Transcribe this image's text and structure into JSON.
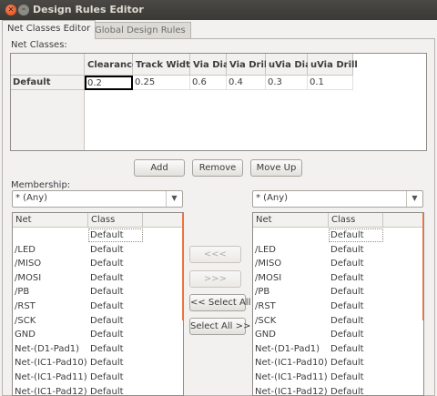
{
  "window": {
    "title": "Design Rules Editor"
  },
  "tabs": [
    {
      "label": "Net Classes Editor",
      "active": true
    },
    {
      "label": "Global Design Rules",
      "active": false
    }
  ],
  "net_classes": {
    "label": "Net Classes:",
    "columns": [
      "Clearance",
      "Track Width",
      "Via Dia",
      "Via Drill",
      "uVia Dia",
      "uVia Drill"
    ],
    "rows": [
      {
        "name": "Default",
        "values": [
          "0.2",
          "0.25",
          "0.6",
          "0.4",
          "0.3",
          "0.1"
        ]
      }
    ],
    "buttons": {
      "add": "Add",
      "remove": "Remove",
      "move_up": "Move Up"
    }
  },
  "membership": {
    "label": "Membership:",
    "left_filter": "* (Any)",
    "right_filter": "* (Any)",
    "columns": [
      "Net",
      "Class"
    ],
    "left_rows": [
      {
        "net": "",
        "class": "Default"
      },
      {
        "net": "/LED",
        "class": "Default"
      },
      {
        "net": "/MISO",
        "class": "Default"
      },
      {
        "net": "/MOSI",
        "class": "Default"
      },
      {
        "net": "/PB",
        "class": "Default"
      },
      {
        "net": "/RST",
        "class": "Default"
      },
      {
        "net": "/SCK",
        "class": "Default"
      },
      {
        "net": "GND",
        "class": "Default"
      },
      {
        "net": "Net-(D1-Pad1)",
        "class": "Default"
      },
      {
        "net": "Net-(IC1-Pad10)",
        "class": "Default"
      },
      {
        "net": "Net-(IC1-Pad11)",
        "class": "Default"
      },
      {
        "net": "Net-(IC1-Pad12)",
        "class": "Default"
      }
    ],
    "right_rows": [
      {
        "net": "",
        "class": "Default"
      },
      {
        "net": "/LED",
        "class": "Default"
      },
      {
        "net": "/MISO",
        "class": "Default"
      },
      {
        "net": "/MOSI",
        "class": "Default"
      },
      {
        "net": "/PB",
        "class": "Default"
      },
      {
        "net": "/RST",
        "class": "Default"
      },
      {
        "net": "/SCK",
        "class": "Default"
      },
      {
        "net": "GND",
        "class": "Default"
      },
      {
        "net": "Net-(D1-Pad1)",
        "class": "Default"
      },
      {
        "net": "Net-(IC1-Pad10)",
        "class": "Default"
      },
      {
        "net": "Net-(IC1-Pad11)",
        "class": "Default"
      },
      {
        "net": "Net-(IC1-Pad12)",
        "class": "Default"
      }
    ],
    "buttons": {
      "move_left": "<<<",
      "move_right": ">>>",
      "select_all_left": "<< Select All",
      "select_all_right": "Select All >>"
    }
  },
  "colors": {
    "titlebar": "#3c3b37",
    "close_button": "#df4a16",
    "scroll_accent": "#f07746"
  }
}
